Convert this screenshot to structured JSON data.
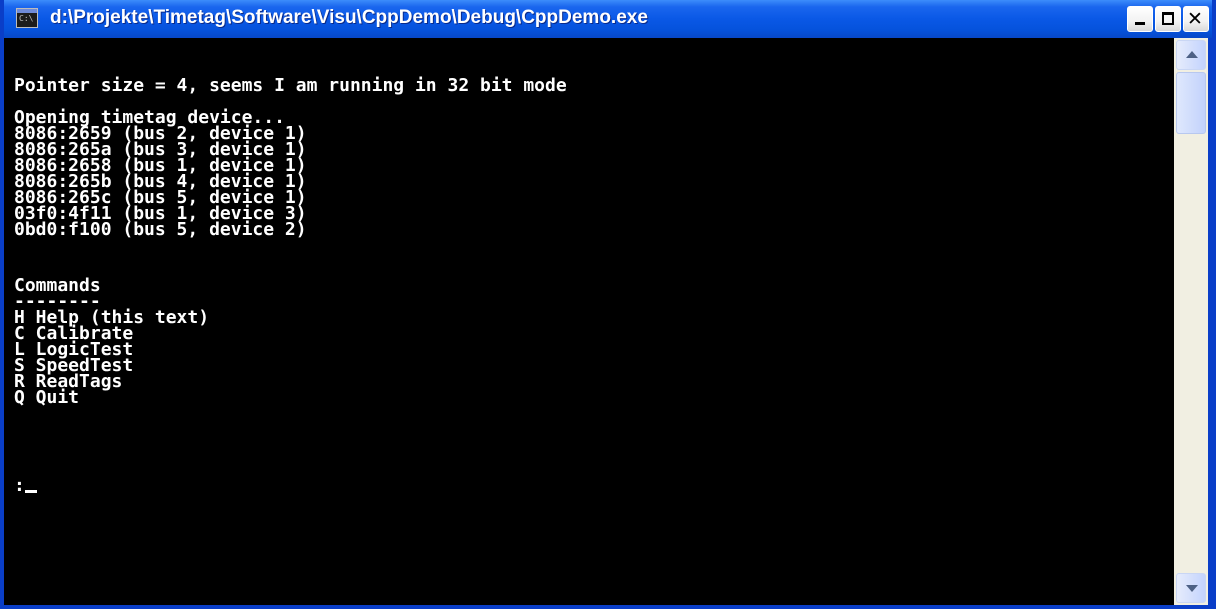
{
  "window": {
    "title": "d:\\Projekte\\Timetag\\Software\\Visu\\CppDemo\\Debug\\CppDemo.exe",
    "icon": "console-app-icon",
    "icon_text": "C:\\",
    "minimize_icon": "minimize-icon",
    "maximize_icon": "maximize-icon",
    "close_icon": "close-icon",
    "close_glyph": "✕"
  },
  "console": {
    "background_color": "#000000",
    "text_color": "#ffffff",
    "pointer_line": "Pointer size = 4, seems I am running in 32 bit mode",
    "opening_line": "Opening timetag device...",
    "devices": [
      "8086:2659 (bus 2, device 1)",
      "8086:265a (bus 3, device 1)",
      "8086:2658 (bus 1, device 1)",
      "8086:265b (bus 4, device 1)",
      "8086:265c (bus 5, device 1)",
      "03f0:4f11 (bus 1, device 3)",
      "0bd0:f100 (bus 5, device 2)"
    ],
    "commands_heading": "Commands",
    "commands_underline": "--------",
    "commands": [
      "H Help (this text)",
      "C Calibrate",
      "L LogicTest",
      "S SpeedTest",
      "R ReadTags",
      "Q Quit"
    ],
    "prompt": ":"
  },
  "scrollbar": {
    "up_icon": "scroll-up-arrow-icon",
    "down_icon": "scroll-down-arrow-icon"
  }
}
